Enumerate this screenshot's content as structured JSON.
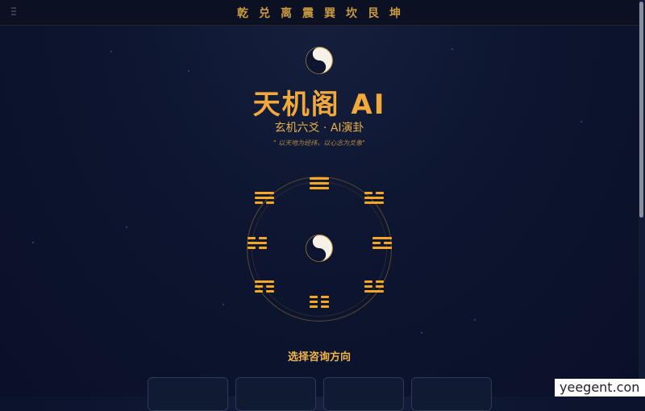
{
  "topbar": {
    "trigrams": [
      "乾",
      "兑",
      "离",
      "震",
      "巽",
      "坎",
      "艮",
      "坤"
    ]
  },
  "hero": {
    "title": "天机阁 AI",
    "subtitle": "玄机六爻 · AI演卦",
    "motto": "\" 以天地为经纬，以心念为爻象\""
  },
  "bagua": {
    "positions": [
      "top",
      "top-right",
      "right",
      "bottom-right",
      "bottom",
      "bottom-left",
      "left",
      "top-left"
    ]
  },
  "consult": {
    "title": "选择咨询方向"
  },
  "watermark": {
    "text": "yeegent.con"
  },
  "colors": {
    "accent": "#f5a623",
    "background": "#0d1530",
    "gold_text": "#f2b64a"
  }
}
